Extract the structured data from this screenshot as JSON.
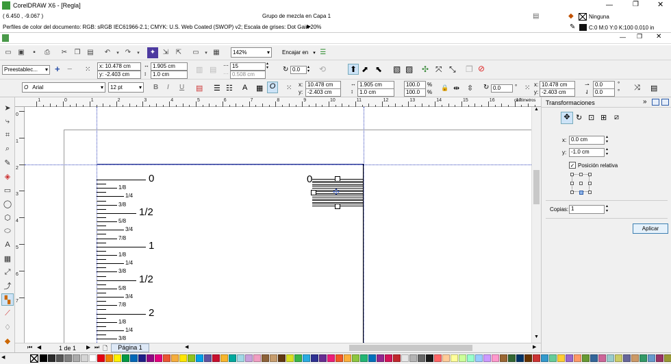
{
  "app": {
    "title": "CorelDRAW X6 - [Regla]"
  },
  "status": {
    "coords": "( 6.450 , -9.067 )",
    "object_info": "Grupo de mezcla en Capa 1",
    "color_profile": "Perfiles de color del documento: RGB: sRGB IEC61966-2.1; CMYK: U.S. Web Coated (SWOP) v2; Escala de grises: Dot Gain 20%",
    "fill_label": "Ninguna",
    "outline_label": "C:0 M:0 Y:0 K:100  0.010 in"
  },
  "toolbar": {
    "zoom": "142%",
    "snap": "Encajar en"
  },
  "propbar": {
    "preset": "Preestablec...",
    "x": "x: 10.478 cm",
    "y": "y: -2.403 cm",
    "w": "1.905 cm",
    "h": "1.0 cm",
    "steps": "15",
    "spacing": "0.508 cm",
    "angle": "0.0"
  },
  "textbar": {
    "font": "Arial",
    "size": "12 pt",
    "x": "10.478 cm",
    "y": "-2.403 cm",
    "w": "1.905 cm",
    "h": "1.0 cm",
    "sx": "100.0",
    "sy": "100.0",
    "pct": "%",
    "rot": "0.0",
    "x2": "10.478 cm",
    "y2": "-2.403 cm",
    "p1": "0.0",
    "p2": "0.0"
  },
  "ruler": {
    "unit": "centímetros",
    "h_numbers": [
      "1",
      "0",
      "1",
      "2",
      "3",
      "4",
      "5",
      "6",
      "7",
      "8",
      "9",
      "10",
      "11",
      "12",
      "13",
      "14",
      "15",
      "16",
      "17"
    ],
    "v_numbers": [
      "0",
      "1",
      "2",
      "3",
      "4",
      "5",
      "6",
      "7"
    ]
  },
  "drawing": {
    "big": [
      "0",
      "1/2",
      "1",
      "1/2",
      "2"
    ],
    "small": [
      "1/8",
      "1/4",
      "3/8",
      "5/8",
      "3/4",
      "7/8",
      "1/8",
      "1/4",
      "3/8",
      "5/8",
      "3/4",
      "7/8",
      "1/8",
      "1/4",
      "3/8"
    ],
    "obj_label": "0"
  },
  "pages": {
    "counter": "1 de 1",
    "tab": "Página 1"
  },
  "docker": {
    "title": "Transformaciones",
    "x_label": "x:",
    "x_value": "0.0 cm",
    "y_label": "y:",
    "y_value": "-1.0 cm",
    "relative": "Posición relativa",
    "copies_label": "Copias:",
    "copies_value": "1",
    "apply": "Aplicar"
  },
  "palette": [
    "#000000",
    "#2b2b2b",
    "#555555",
    "#808080",
    "#aaaaaa",
    "#d4d4d4",
    "#ffffff",
    "#e60012",
    "#f08300",
    "#fff100",
    "#009944",
    "#0068b7",
    "#1d2088",
    "#920783",
    "#e4007f",
    "#ea5532",
    "#f6ad3c",
    "#ffe600",
    "#8fc31f",
    "#00a0e9",
    "#5f52a0",
    "#c8102e",
    "#f7b52c",
    "#00a99d",
    "#a1d8e6",
    "#c9a0dc",
    "#f19ec2",
    "#8c6239",
    "#c69c6d",
    "#603813",
    "#d9e021",
    "#39b54a",
    "#29abe2",
    "#2e3192",
    "#662d91",
    "#ed1e79",
    "#f15a24",
    "#fbb03b",
    "#8cc63f",
    "#22b573",
    "#0071bc",
    "#93278f",
    "#d4145a",
    "#c1272d",
    "#e6e6e6",
    "#b3b3b3",
    "#666666",
    "#1a1a1a",
    "#ff6666",
    "#ffcc99",
    "#ffff99",
    "#ccff99",
    "#99ffcc",
    "#99ccff",
    "#cc99ff",
    "#ff99cc",
    "#996633",
    "#336633",
    "#003366",
    "#663300",
    "#cc3333",
    "#3399cc",
    "#66cc99",
    "#ffcc33",
    "#9966cc",
    "#ff9966",
    "#669933",
    "#336699",
    "#cc6699",
    "#99cccc",
    "#cccc66",
    "#666699",
    "#cc9966",
    "#339966",
    "#6699cc",
    "#993366",
    "#999933",
    "#339999",
    "#996699",
    "#cc6633"
  ]
}
